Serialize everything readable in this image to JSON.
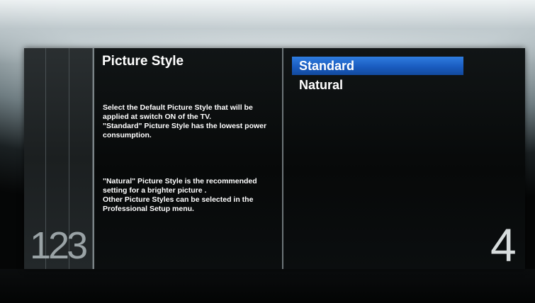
{
  "menu": {
    "title": "Picture Style",
    "level_indicator": "123",
    "current_level": "4",
    "description_1": "Select the Default Picture Style that will be\napplied at switch ON of the TV.\n\"Standard\" Picture Style has the lowest power\nconsumption.",
    "description_2": "\"Natural\" Picture Style is the recommended\nsetting for a brighter picture .\nOther Picture Styles can be selected in the\nProfessional Setup menu.",
    "options": [
      {
        "label": "Standard",
        "selected": true
      },
      {
        "label": "Natural",
        "selected": false
      }
    ]
  },
  "colors": {
    "highlight": "#1f68cf",
    "text": "#ffffff",
    "panel": "#0a0d0e"
  }
}
